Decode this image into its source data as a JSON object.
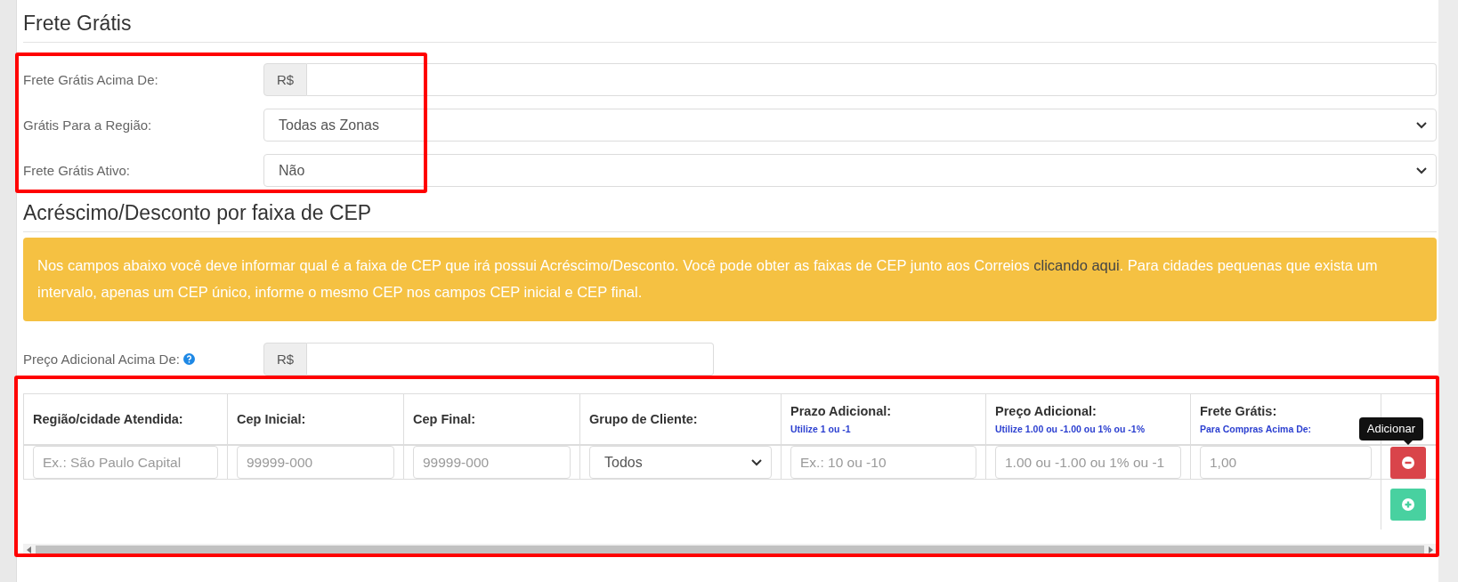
{
  "free_shipping": {
    "title": "Frete Grátis",
    "highlighted": true,
    "fields": [
      {
        "kind": "currency",
        "label": "Frete Grátis Acima De:",
        "prefix": "R$"
      },
      {
        "kind": "select",
        "label": "Grátis Para a Região:",
        "value": "Todas as Zonas"
      },
      {
        "kind": "select",
        "label": "Frete Grátis Ativo:",
        "value": "Não"
      }
    ]
  },
  "cep_ranges": {
    "title": "Acréscimo/Desconto por faixa de CEP",
    "alert": {
      "text_before": "Nos campos abaixo você deve informar qual é a faixa de CEP que irá possui Acréscimo/Desconto. Você pode obter as faixas de CEP junto aos Correios ",
      "link": "clicando aqui",
      "text_after": ". Para cidades pequenas que exista um intervalo, apenas um CEP único, informe o mesmo CEP nos campos CEP inicial e CEP final."
    },
    "extra_price": {
      "label": "Preço Adicional Acima De:",
      "prefix": "R$"
    },
    "table": {
      "highlighted": true,
      "columns": [
        {
          "title": "Região/cidade Atendida:"
        },
        {
          "title": "Cep Inicial:"
        },
        {
          "title": "Cep Final:"
        },
        {
          "title": "Grupo de Cliente:"
        },
        {
          "title": "Prazo Adicional:",
          "hint": "Utilize 1 ou -1"
        },
        {
          "title": "Preço Adicional:",
          "hint": "Utilize 1.00 ou -1.00 ou 1% ou -1%"
        },
        {
          "title": "Frete Grátis:",
          "hint": "Para Compras Acima De:"
        }
      ],
      "rows": [
        {
          "cells": [
            {
              "kind": "input",
              "placeholder": "Ex.: São Paulo Capital"
            },
            {
              "kind": "input",
              "placeholder": "99999-000"
            },
            {
              "kind": "input",
              "placeholder": "99999-000"
            },
            {
              "kind": "select",
              "value": "Todos"
            },
            {
              "kind": "input",
              "placeholder": "Ex.: 10 ou -10"
            },
            {
              "kind": "input",
              "placeholder": "1.00 ou -1.00 ou 1% ou -1"
            },
            {
              "kind": "input",
              "placeholder": "1,00"
            }
          ]
        }
      ],
      "tooltip": "Adicionar"
    }
  }
}
